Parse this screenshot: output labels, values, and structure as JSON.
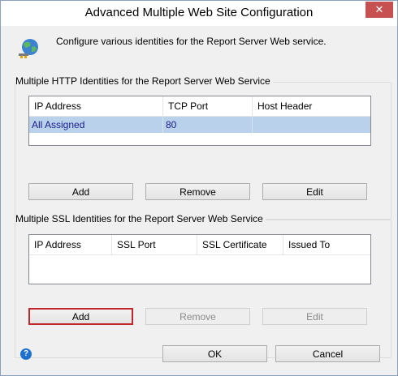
{
  "window": {
    "title": "Advanced Multiple Web Site Configuration",
    "close_glyph": "✕"
  },
  "intro": "Configure various identities for the Report Server Web service.",
  "http": {
    "group_label": "Multiple HTTP Identities for the Report Server Web Service",
    "columns": [
      "IP Address",
      "TCP Port",
      "Host Header"
    ],
    "rows": [
      {
        "ip": "All Assigned",
        "port": "80",
        "host": ""
      }
    ],
    "buttons": {
      "add": "Add",
      "remove": "Remove",
      "edit": "Edit"
    }
  },
  "ssl": {
    "group_label": "Multiple SSL Identities for the Report Server Web Service",
    "columns": [
      "IP Address",
      "SSL Port",
      "SSL Certificate",
      "Issued To"
    ],
    "rows": [],
    "buttons": {
      "add": "Add",
      "remove": "Remove",
      "edit": "Edit"
    }
  },
  "footer": {
    "ok": "OK",
    "cancel": "Cancel",
    "help_glyph": "?"
  },
  "colors": {
    "selected_row": "#b9d1ea",
    "focus_border": "#c0272d",
    "close_button": "#c75050"
  },
  "icons": {
    "globe": "globe-network-icon",
    "help": "help-icon",
    "close": "close-icon"
  }
}
